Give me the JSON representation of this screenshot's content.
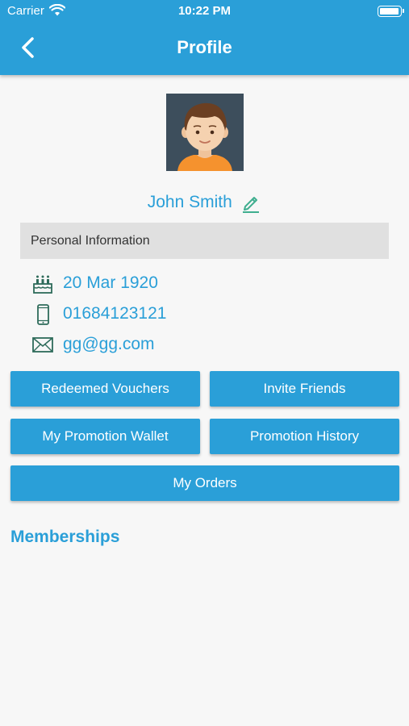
{
  "status_bar": {
    "carrier": "Carrier",
    "time": "10:22 PM"
  },
  "header": {
    "title": "Profile",
    "back_icon": "chevron-left-icon",
    "background": "#2a9fd8"
  },
  "profile": {
    "name": "John Smith",
    "edit_icon": "pencil-icon"
  },
  "personal_info": {
    "section_label": "Personal Information",
    "birthday": "20 Mar 1920",
    "phone": "01684123121",
    "email": "gg@gg.com"
  },
  "buttons": {
    "redeemed_vouchers": "Redeemed Vouchers",
    "invite_friends": "Invite Friends",
    "promotion_wallet": "My Promotion Wallet",
    "promotion_history": "Promotion History",
    "my_orders": "My Orders"
  },
  "memberships": {
    "heading": "Memberships"
  },
  "colors": {
    "accent": "#2a9fd8",
    "section_bg": "#e0e0e0",
    "icon_green": "#2e6b5a"
  }
}
